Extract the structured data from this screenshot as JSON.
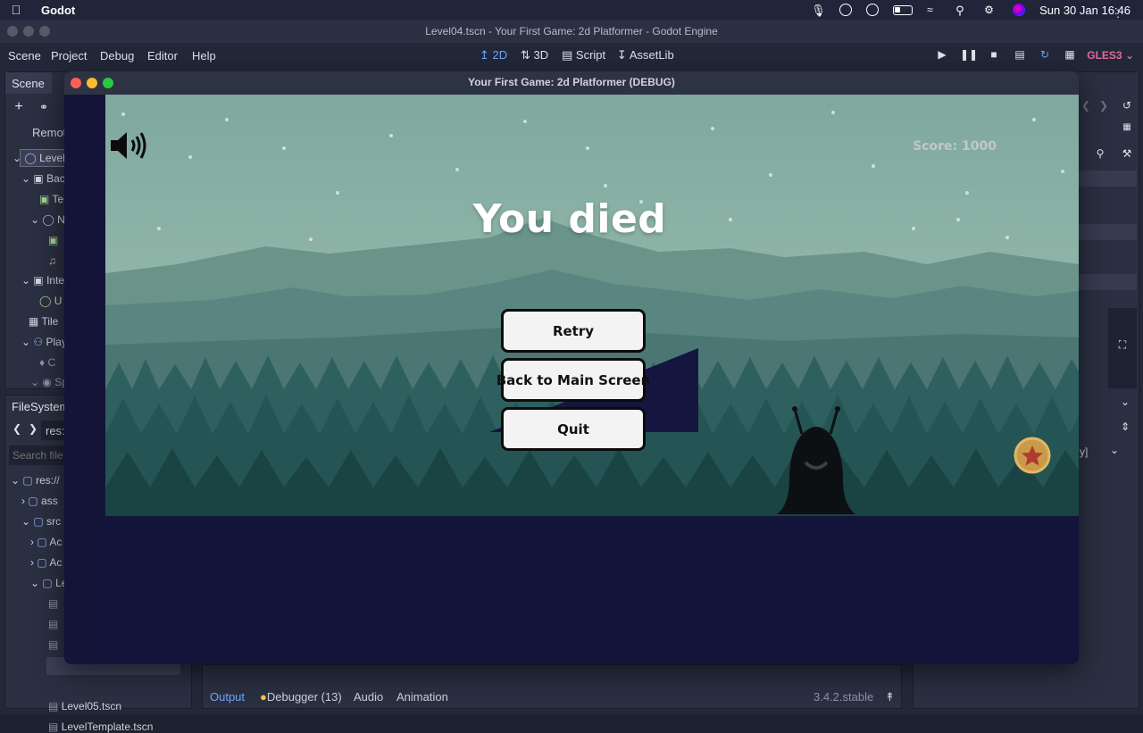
{
  "macos": {
    "app_name": "Godot",
    "datetime": "Sun 30 Jan  16:46"
  },
  "editor": {
    "window_title": "Level04.tscn - Your First Game: 2d Platformer - Godot Engine",
    "menu": [
      "Scene",
      "Project",
      "Debug",
      "Editor",
      "Help"
    ],
    "modes": [
      "2D",
      "3D",
      "Script",
      "AssetLib"
    ],
    "renderer": "GLES3",
    "scene_panel": {
      "tab": "Scene",
      "remote_label": "Remot",
      "tree": [
        "Level",
        "Bac",
        "Te",
        "N",
        "Inte",
        "U",
        "Tile",
        "Play",
        "C",
        "Sp"
      ]
    },
    "filesystem": {
      "tab": "FileSystem",
      "path": "res:/",
      "search_placeholder": "Search file",
      "items": [
        "res://",
        "ass",
        "src",
        "Ac",
        "Ac",
        "Le",
        "Level05.tscn",
        "LevelTemplate.tscn"
      ]
    },
    "bottom_tabs": [
      "Output",
      "Debugger (13)",
      "Audio",
      "Animation"
    ],
    "version": "3.4.2.stable"
  },
  "game": {
    "window_title": "Your First Game: 2d Platformer (DEBUG)",
    "score_text": "Score: 1000",
    "heading": "You died",
    "buttons": {
      "retry": "Retry",
      "main": "Back to Main Screen",
      "quit": "Quit"
    },
    "colors": {
      "sky": "#8ab8a8",
      "ground": "#13143a",
      "button_bg": "#f3f3f3"
    }
  }
}
